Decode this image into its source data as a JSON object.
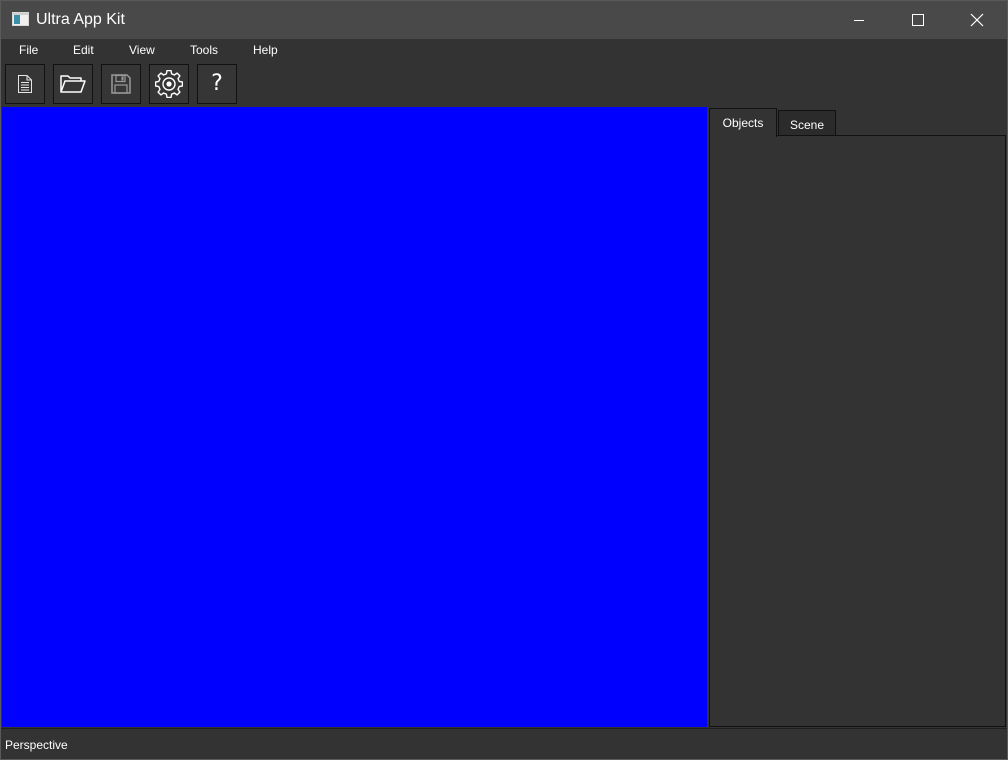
{
  "window": {
    "title": "Ultra App Kit"
  },
  "menu": {
    "items": [
      {
        "label": "File"
      },
      {
        "label": "Edit"
      },
      {
        "label": "View"
      },
      {
        "label": "Tools"
      },
      {
        "label": "Help"
      }
    ]
  },
  "toolbar": {
    "buttons": [
      {
        "icon": "new-document-icon"
      },
      {
        "icon": "open-folder-icon"
      },
      {
        "icon": "save-disk-icon"
      },
      {
        "icon": "gear-icon"
      },
      {
        "icon": "help-icon",
        "label": "?"
      }
    ]
  },
  "viewport": {
    "background": "#0000ff"
  },
  "side_panel": {
    "tabs": [
      {
        "label": "Objects",
        "active": true
      },
      {
        "label": "Scene",
        "active": false
      }
    ]
  },
  "status": {
    "text": "Perspective"
  },
  "colors": {
    "titlebar": "#494949",
    "background": "#333333",
    "viewport": "#0000ff",
    "border": "#111111"
  }
}
